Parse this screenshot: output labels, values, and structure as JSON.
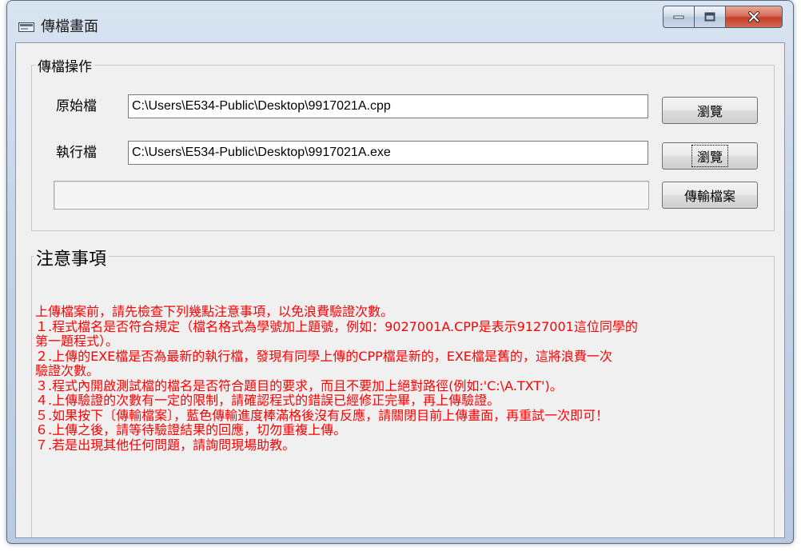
{
  "window": {
    "title": "傳檔畫面",
    "controls": {
      "minimize": "minimize",
      "maximize": "maximize",
      "close": "close"
    }
  },
  "file_ops": {
    "legend": "傳檔操作",
    "source": {
      "label": "原始檔",
      "value": "C:\\Users\\E534-Public\\Desktop\\9917021A.cpp",
      "button": "瀏覽"
    },
    "exec": {
      "label": "執行檔",
      "value": "C:\\Users\\E534-Public\\Desktop\\9917021A.exe",
      "button": "瀏覽"
    },
    "progress": 0,
    "upload_button": "傳輸檔案"
  },
  "notes": {
    "legend": "注意事項",
    "lines": [
      "上傳檔案前，請先檢查下列幾點注意事項，以免浪費驗證次數。",
      "１.程式檔名是否符合規定（檔名格式為學號加上題號，例如：9027001A.CPP是表示9127001這位同學的",
      "第一題程式）。",
      "２.上傳的EXE檔是否為最新的執行檔，發現有同學上傳的CPP檔是新的，EXE檔是舊的，這將浪費一次",
      "驗證次數。",
      "３.程式內開啟測試檔的檔名是否符合題目的要求，而且不要加上絕對路徑(例如:'C:\\A.TXT')。",
      "４.上傳驗證的次數有一定的限制，請確認程式的錯誤已經修正完畢，再上傳驗證。",
      "５.如果按下〔傳輸檔案〕，藍色傳輸進度棒滿格後沒有反應，請關閉目前上傳畫面，再重試一次即可！",
      "６.上傳之後，請等待驗證結果的回應，切勿重複上傳。",
      "７.若是出現其他任何問題，請詢問現場助教。"
    ]
  },
  "colors": {
    "notes_text": "#ff0000",
    "client_bg": "#f0f0f0"
  }
}
